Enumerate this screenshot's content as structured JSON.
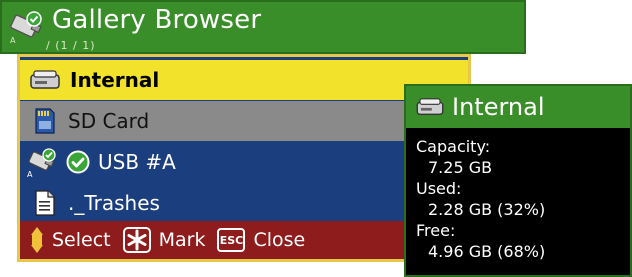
{
  "header": {
    "title": "Gallery Browser",
    "path": "/ (1 / 1)"
  },
  "drives": [
    {
      "label": "Internal",
      "icon": "hard-drive-icon",
      "selected": true
    },
    {
      "label": "SD Card",
      "icon": "sd-card-icon"
    },
    {
      "label": "USB #A",
      "icon": "usb-drive-icon",
      "status_icon": "check-circle-icon"
    },
    {
      "label": "._Trashes",
      "icon": "document-icon"
    }
  ],
  "footer": {
    "select": "Select",
    "mark": "Mark",
    "esc_key": "ESC",
    "close": "Close"
  },
  "info": {
    "title": "Internal",
    "capacity_label": "Capacity:",
    "capacity_value": "7.25 GB",
    "used_label": "Used:",
    "used_value": "2.28 GB (32%)",
    "free_label": "Free:",
    "free_value": "4.96 GB (68%)"
  },
  "colors": {
    "title_green": "#3a8e2a",
    "list_blue": "#1b3e7e",
    "selected_yellow": "#f3e22c",
    "footer_red": "#8f1c1c"
  }
}
